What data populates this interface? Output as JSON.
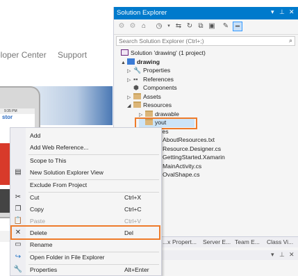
{
  "browser": {
    "nav_developer_center": "eloper Center",
    "nav_support": "Support",
    "phone_store": "stor",
    "phone_time": "9:35 PM"
  },
  "solution_explorer": {
    "title": "Solution Explorer",
    "title_icons": [
      "dropdown-arrow-icon",
      "pin-icon",
      "close-icon"
    ],
    "toolbar_icons": [
      "back-icon",
      "forward-icon",
      "home-icon",
      "history-icon",
      "sync-icon",
      "refresh-icon",
      "collapse-all-icon",
      "show-all-files-icon",
      "properties-icon",
      "preview-icon"
    ],
    "search_placeholder": "Search Solution Explorer (Ctrl+;)",
    "tree": [
      {
        "label": "Solution 'drawing' (1 project)",
        "icon": "solution-icon",
        "arrow": ""
      },
      {
        "label": "drawing",
        "icon": "project-icon",
        "arrow": "▲",
        "bold": true
      },
      {
        "label": "Properties",
        "icon": "wrench-icon",
        "arrow": "▷"
      },
      {
        "label": "References",
        "icon": "references-icon",
        "arrow": "▷"
      },
      {
        "label": "Components",
        "icon": "components-icon",
        "arrow": ""
      },
      {
        "label": "Assets",
        "icon": "folder-icon",
        "arrow": "▷"
      },
      {
        "label": "Resources",
        "icon": "folder-icon",
        "arrow": "◢"
      },
      {
        "label": "drawable",
        "icon": "folder-icon",
        "arrow": "▷"
      },
      {
        "label": "layout",
        "icon": "folder-icon",
        "arrow": ""
      },
      {
        "label": "values",
        "icon": "folder-icon",
        "arrow": "▷"
      },
      {
        "label": "AboutResources.txt",
        "icon": "file-icon",
        "arrow": ""
      },
      {
        "label": "Resource.Designer.cs",
        "icon": "file-icon",
        "arrow": ""
      },
      {
        "label": "GettingStarted.Xamarin",
        "icon": "file-icon",
        "arrow": ""
      },
      {
        "label": "MainActivity.cs",
        "icon": "file-icon",
        "arrow": ""
      },
      {
        "label": "OvalShape.cs",
        "icon": "file-icon",
        "arrow": ""
      }
    ],
    "tree_visible_text": {
      "drawable": "drawable",
      "layout": "yout",
      "values": "alues",
      "about": "AboutResources.txt",
      "designer": "Resource.Designer.cs",
      "getting": "GettingStarted.Xamarin",
      "main": "MainActivity.cs",
      "oval": "OvalShape.cs"
    },
    "tabs": [
      "...x",
      "Propert...",
      "Server E...",
      "Team E...",
      "Class Vi..."
    ]
  },
  "context_menu": {
    "items": [
      {
        "label": "Add",
        "shortcut": "",
        "icon": "",
        "has_submenu": true
      },
      {
        "label": "Add Web Reference...",
        "shortcut": "",
        "icon": ""
      },
      {
        "label": "Scope to This",
        "shortcut": "",
        "icon": ""
      },
      {
        "label": "New Solution Explorer View",
        "shortcut": "",
        "icon": "new-view-icon"
      },
      {
        "label": "Exclude From Project",
        "shortcut": "",
        "icon": ""
      },
      {
        "label": "Cut",
        "shortcut": "Ctrl+X",
        "icon": "scissors-icon"
      },
      {
        "label": "Copy",
        "shortcut": "Ctrl+C",
        "icon": "copy-icon"
      },
      {
        "label": "Paste",
        "shortcut": "Ctrl+V",
        "icon": "paste-icon",
        "disabled": true
      },
      {
        "label": "Delete",
        "shortcut": "Del",
        "icon": "delete-x-icon"
      },
      {
        "label": "Rename",
        "shortcut": "",
        "icon": "rename-icon"
      },
      {
        "label": "Open Folder in File Explorer",
        "shortcut": "",
        "icon": "open-folder-icon"
      },
      {
        "label": "Properties",
        "shortcut": "Alt+Enter",
        "icon": "wrench-icon"
      }
    ]
  },
  "colors": {
    "accent_blue": "#007acc",
    "highlight_orange": "#ee7b2a",
    "menu_bg": "#f5f5f5"
  }
}
